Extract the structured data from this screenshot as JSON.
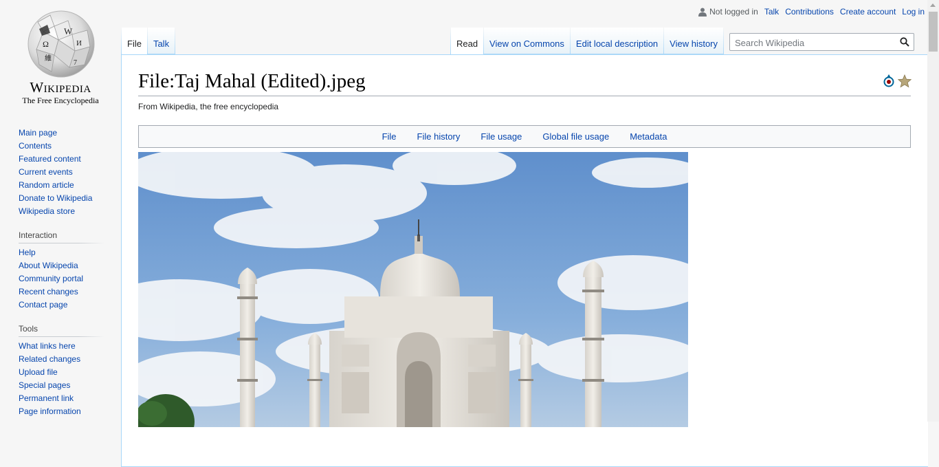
{
  "personal": {
    "icon": "user-icon",
    "not_logged_in": "Not logged in",
    "talk": "Talk",
    "contributions": "Contributions",
    "create_account": "Create account",
    "login": "Log in"
  },
  "logo": {
    "wordmark": "Wikipedia",
    "tagline": "The Free Encyclopedia"
  },
  "sidebar": {
    "navigation": [
      "Main page",
      "Contents",
      "Featured content",
      "Current events",
      "Random article",
      "Donate to Wikipedia",
      "Wikipedia store"
    ],
    "interaction_heading": "Interaction",
    "interaction": [
      "Help",
      "About Wikipedia",
      "Community portal",
      "Recent changes",
      "Contact page"
    ],
    "tools_heading": "Tools",
    "tools": [
      "What links here",
      "Related changes",
      "Upload file",
      "Special pages",
      "Permanent link",
      "Page information"
    ]
  },
  "tabs": {
    "left": [
      "File",
      "Talk"
    ],
    "right": [
      "Read",
      "View on Commons",
      "Edit local description",
      "View history"
    ]
  },
  "search": {
    "placeholder": "Search Wikipedia",
    "icon": "search-icon"
  },
  "page": {
    "title": "File:Taj Mahal (Edited).jpeg",
    "subtitle": "From Wikipedia, the free encyclopedia",
    "indicators": [
      "commons-icon",
      "featured-star-icon"
    ],
    "file_toc": [
      "File",
      "File history",
      "File usage",
      "Global file usage",
      "Metadata"
    ]
  },
  "colors": {
    "link": "#0645ad",
    "border": "#a7d7f9",
    "sky": "#6e9bd2"
  }
}
